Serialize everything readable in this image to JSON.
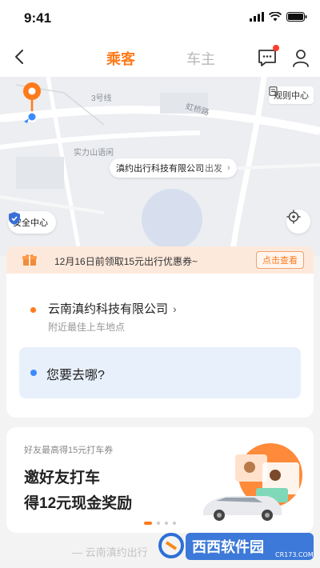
{
  "status_bar": {
    "time": "9:41"
  },
  "nav": {
    "tab_passenger": "乘客",
    "tab_driver": "车主",
    "colors": {
      "active": "#ff7a1a",
      "inactive": "#b8b8b8"
    }
  },
  "map": {
    "road_label_1": "3号线",
    "road_label_2": "虹桥路",
    "place_label": "实力山语闲",
    "rules_label": "规则中心",
    "pickup_name": "滇约出行科技有限公司",
    "pickup_suffix": "出发",
    "safety_label": "安全中心"
  },
  "coupon": {
    "text": "12月16日前领取15元出行优惠券~",
    "button": "点击查看"
  },
  "trip": {
    "start_name": "云南滇约科技有限公司",
    "start_hint": "附近最佳上车地点",
    "destination_placeholder": "您要去哪?"
  },
  "promo": {
    "small_text": "好友最高得15元打车券",
    "line1": "邀好友打车",
    "line2": "得12元现金奖励",
    "carousel_total": 4,
    "carousel_active": 1
  },
  "footer": {
    "text": "— 云南滇约出行"
  },
  "watermark": {
    "brand": "西西软件园",
    "url": "CR173.COM"
  }
}
